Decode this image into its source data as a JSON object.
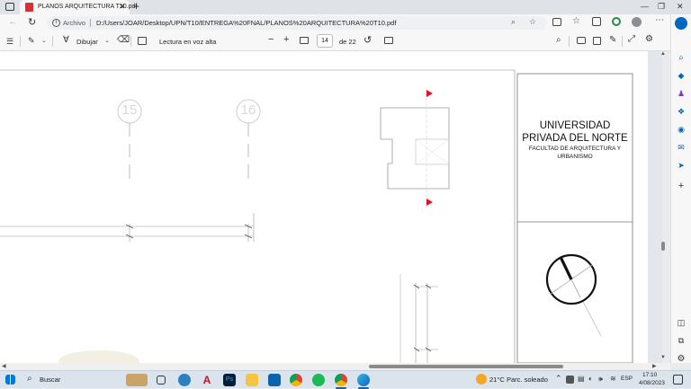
{
  "browser": {
    "tab_title": "PLANOS ARQUITECTURA T10.pdf",
    "address_label": "Archivo",
    "url": "D:/Users/JOAR/Desktop/UPN/T10/ENTREGA%20FNAL/PLANOS%20ARQUITECTURA%20T10.pdf"
  },
  "pdf_toolbar": {
    "draw_label": "Dibujar",
    "read_aloud_label": "Lectura en voz alta",
    "page_number": "14",
    "page_total": "de 22"
  },
  "drawing": {
    "axis_1": "15",
    "axis_2": "16",
    "university_line1": "UNIVERSIDAD",
    "university_line2": "PRIVADA DEL NORTE",
    "faculty_line1": "FACULTAD DE ARQUITECTURA Y",
    "faculty_line2": "URBANISMO"
  },
  "taskbar": {
    "search_label": "Buscar",
    "weather_temp": "21°C",
    "weather_desc": "Parc. soleado",
    "language": "ESP",
    "time": "17:10",
    "date": "4/08/2023"
  },
  "colors": {
    "accent": "#0067c0",
    "pdf_icon": "#d13438",
    "marker_red": "#e81123"
  }
}
